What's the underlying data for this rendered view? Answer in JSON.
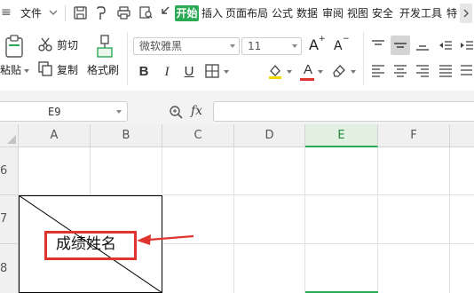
{
  "menubar": {
    "file_label": "文件",
    "tabs": [
      "开始",
      "插入",
      "页面布局",
      "公式",
      "数据",
      "审阅",
      "视图",
      "安全",
      "开发工具",
      "特"
    ],
    "active_tab": "开始"
  },
  "ribbon": {
    "paste_label": "粘贴",
    "cut_label": "剪切",
    "copy_label": "复制",
    "format_painter_label": "格式刷",
    "font_name": "微软雅黑",
    "font_size": "11",
    "grow_font": "A",
    "shrink_font": "A",
    "bold": "B",
    "italic": "I",
    "underline": "U",
    "font_color_letter": "A"
  },
  "formula_bar": {
    "cell_ref": "E9",
    "fx_label": "fx",
    "formula_value": ""
  },
  "grid": {
    "columns": [
      "A",
      "B",
      "C",
      "D",
      "E",
      "F"
    ],
    "selected_column": "E",
    "rows": [
      "6",
      "7",
      "8"
    ],
    "cell_text": "成绩姓名"
  },
  "colors": {
    "accent": "#2aaa55",
    "annotation": "#e0352f"
  }
}
